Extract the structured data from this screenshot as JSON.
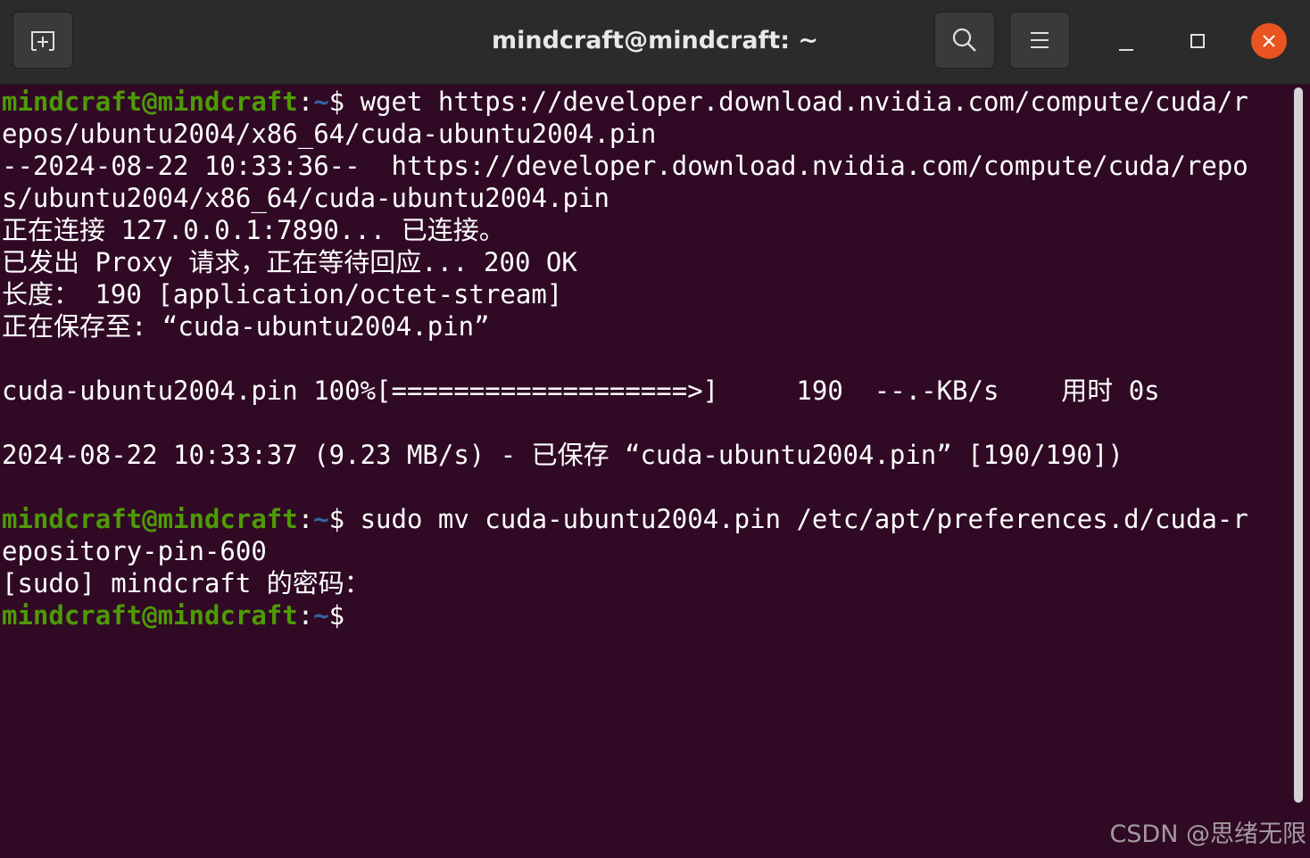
{
  "window": {
    "title": "mindcraft@mindcraft: ~"
  },
  "titlebar": {
    "new_tab_icon": "new-tab-icon",
    "search_icon": "search-icon",
    "menu_icon": "hamburger-menu-icon",
    "minimize_icon": "minimize-icon",
    "maximize_icon": "maximize-icon",
    "close_icon": "close-icon",
    "close_color": "#e95420"
  },
  "colors": {
    "background": "#300a24",
    "prompt_user": "#4e9a06",
    "prompt_path": "#3465a4",
    "text": "#ffffff"
  },
  "prompt": {
    "user": "mindcraft@mindcraft",
    "sep": ":",
    "path": "~",
    "symbol": "$ "
  },
  "terminal": {
    "lines": [
      {
        "prompt": true,
        "text": "wget https://developer.download.nvidia.com/compute/cuda/r"
      },
      {
        "text": "epos/ubuntu2004/x86_64/cuda-ubuntu2004.pin"
      },
      {
        "text": "--2024-08-22 10:33:36--  https://developer.download.nvidia.com/compute/cuda/repo"
      },
      {
        "text": "s/ubuntu2004/x86_64/cuda-ubuntu2004.pin"
      },
      {
        "text": "正在连接 127.0.0.1:7890... 已连接。"
      },
      {
        "text": "已发出 Proxy 请求，正在等待回应... 200 OK"
      },
      {
        "text": "长度： 190 [application/octet-stream]"
      },
      {
        "text": "正在保存至: “cuda-ubuntu2004.pin”"
      },
      {
        "text": ""
      },
      {
        "text": "cuda-ubuntu2004.pin 100%[===================>]     190  --.-KB/s    用时 0s"
      },
      {
        "text": ""
      },
      {
        "text": "2024-08-22 10:33:37 (9.23 MB/s) - 已保存 “cuda-ubuntu2004.pin” [190/190])"
      },
      {
        "text": ""
      },
      {
        "prompt": true,
        "text": "sudo mv cuda-ubuntu2004.pin /etc/apt/preferences.d/cuda-r"
      },
      {
        "text": "epository-pin-600"
      },
      {
        "text": "[sudo] mindcraft 的密码："
      },
      {
        "prompt": true,
        "text": ""
      }
    ]
  },
  "watermark": "CSDN @思绪无限"
}
